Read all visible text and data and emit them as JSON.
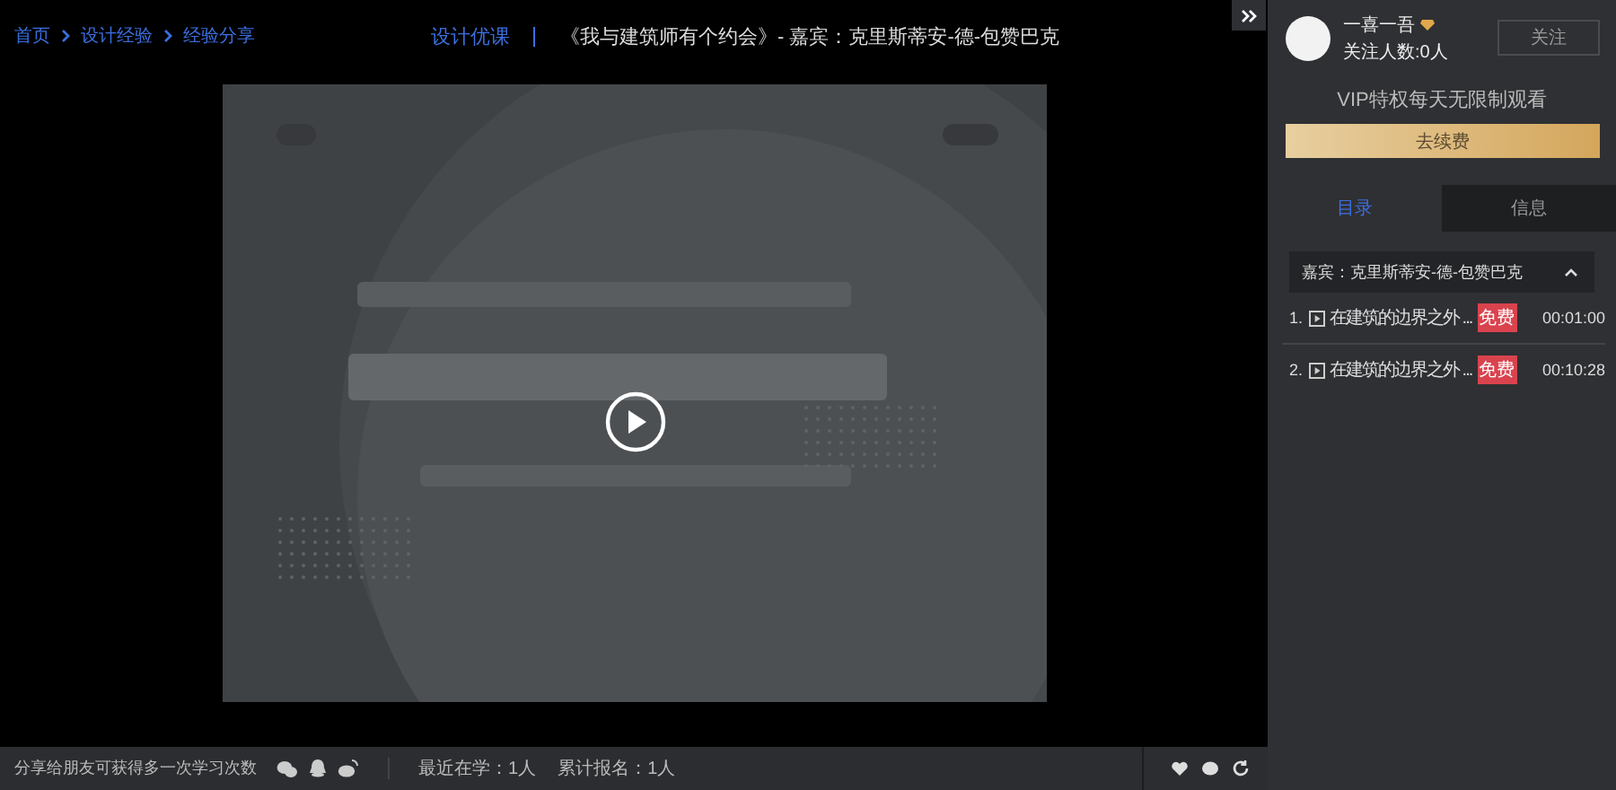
{
  "breadcrumb": [
    "首页",
    "设计经验",
    "经验分享"
  ],
  "header": {
    "category": "设计优课",
    "title": "《我与建筑师有个约会》- 嘉宾：克里斯蒂安-德-包赞巴克"
  },
  "footer": {
    "share_text": "分享给朋友可获得多一次学习次数",
    "stats": [
      "最近在学：1人",
      "累计报名：1人"
    ]
  },
  "author": {
    "name": "一喜一吾",
    "followers": "关注人数:0人",
    "follow_button": "关注"
  },
  "vip": {
    "text": "VIP特权每天无限制观看",
    "button": "去续费"
  },
  "tabs": [
    {
      "label": "目录",
      "selected": true
    },
    {
      "label": "信息",
      "selected": false
    }
  ],
  "chapter": {
    "title": "嘉宾：克里斯蒂安-德-包赞巴克",
    "expanded": true,
    "lessons": [
      {
        "index": "1.",
        "title": "在建筑的边界之外 ...",
        "badge": "免费",
        "duration": "00:01:00"
      },
      {
        "index": "2.",
        "title": "在建筑的边界之外 ...",
        "badge": "免费",
        "duration": "00:10:28"
      }
    ]
  }
}
